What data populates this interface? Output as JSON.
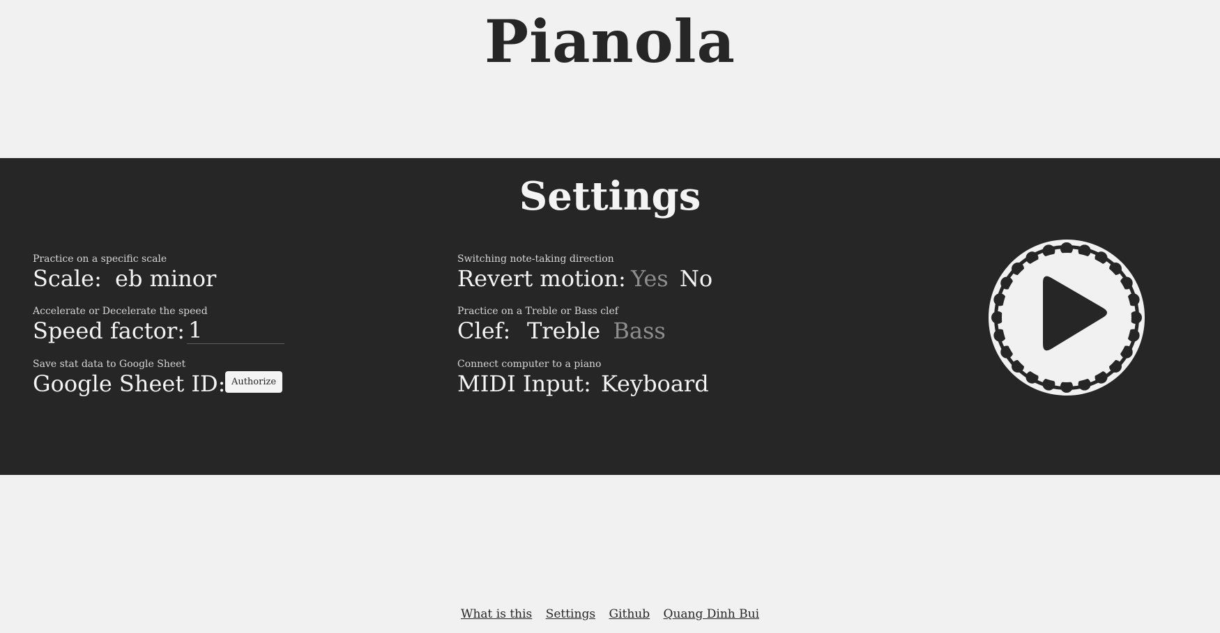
{
  "header": {
    "title": "Pianola"
  },
  "settings": {
    "title": "Settings",
    "scale": {
      "hint": "Practice on a specific scale",
      "label": "Scale:",
      "value": "eb minor"
    },
    "speed": {
      "hint": "Accelerate or Decelerate the speed",
      "label": "Speed factor:",
      "value": "1"
    },
    "sheet": {
      "hint": "Save stat data to Google Sheet",
      "label": "Google Sheet ID:",
      "button": "Authorize"
    },
    "revert": {
      "hint": "Switching note-taking direction",
      "label": "Revert motion:",
      "options": [
        "Yes",
        "No"
      ],
      "selected": "No"
    },
    "clef": {
      "hint": "Practice on a Treble or Bass clef",
      "label": "Clef:",
      "options": [
        "Treble",
        "Bass"
      ],
      "selected": "Treble"
    },
    "midi": {
      "hint": "Connect computer to a piano",
      "label": "MIDI Input:",
      "value": "Keyboard"
    }
  },
  "play": {
    "icon": "play-icon"
  },
  "footer": {
    "links": [
      "What is this",
      "Settings",
      "Github",
      "Quang Dinh Bui"
    ]
  },
  "colors": {
    "background": "#f1f1f1",
    "panel": "#262626",
    "text_light": "#f4f4f4",
    "text_dim": "#8e8e8e"
  }
}
